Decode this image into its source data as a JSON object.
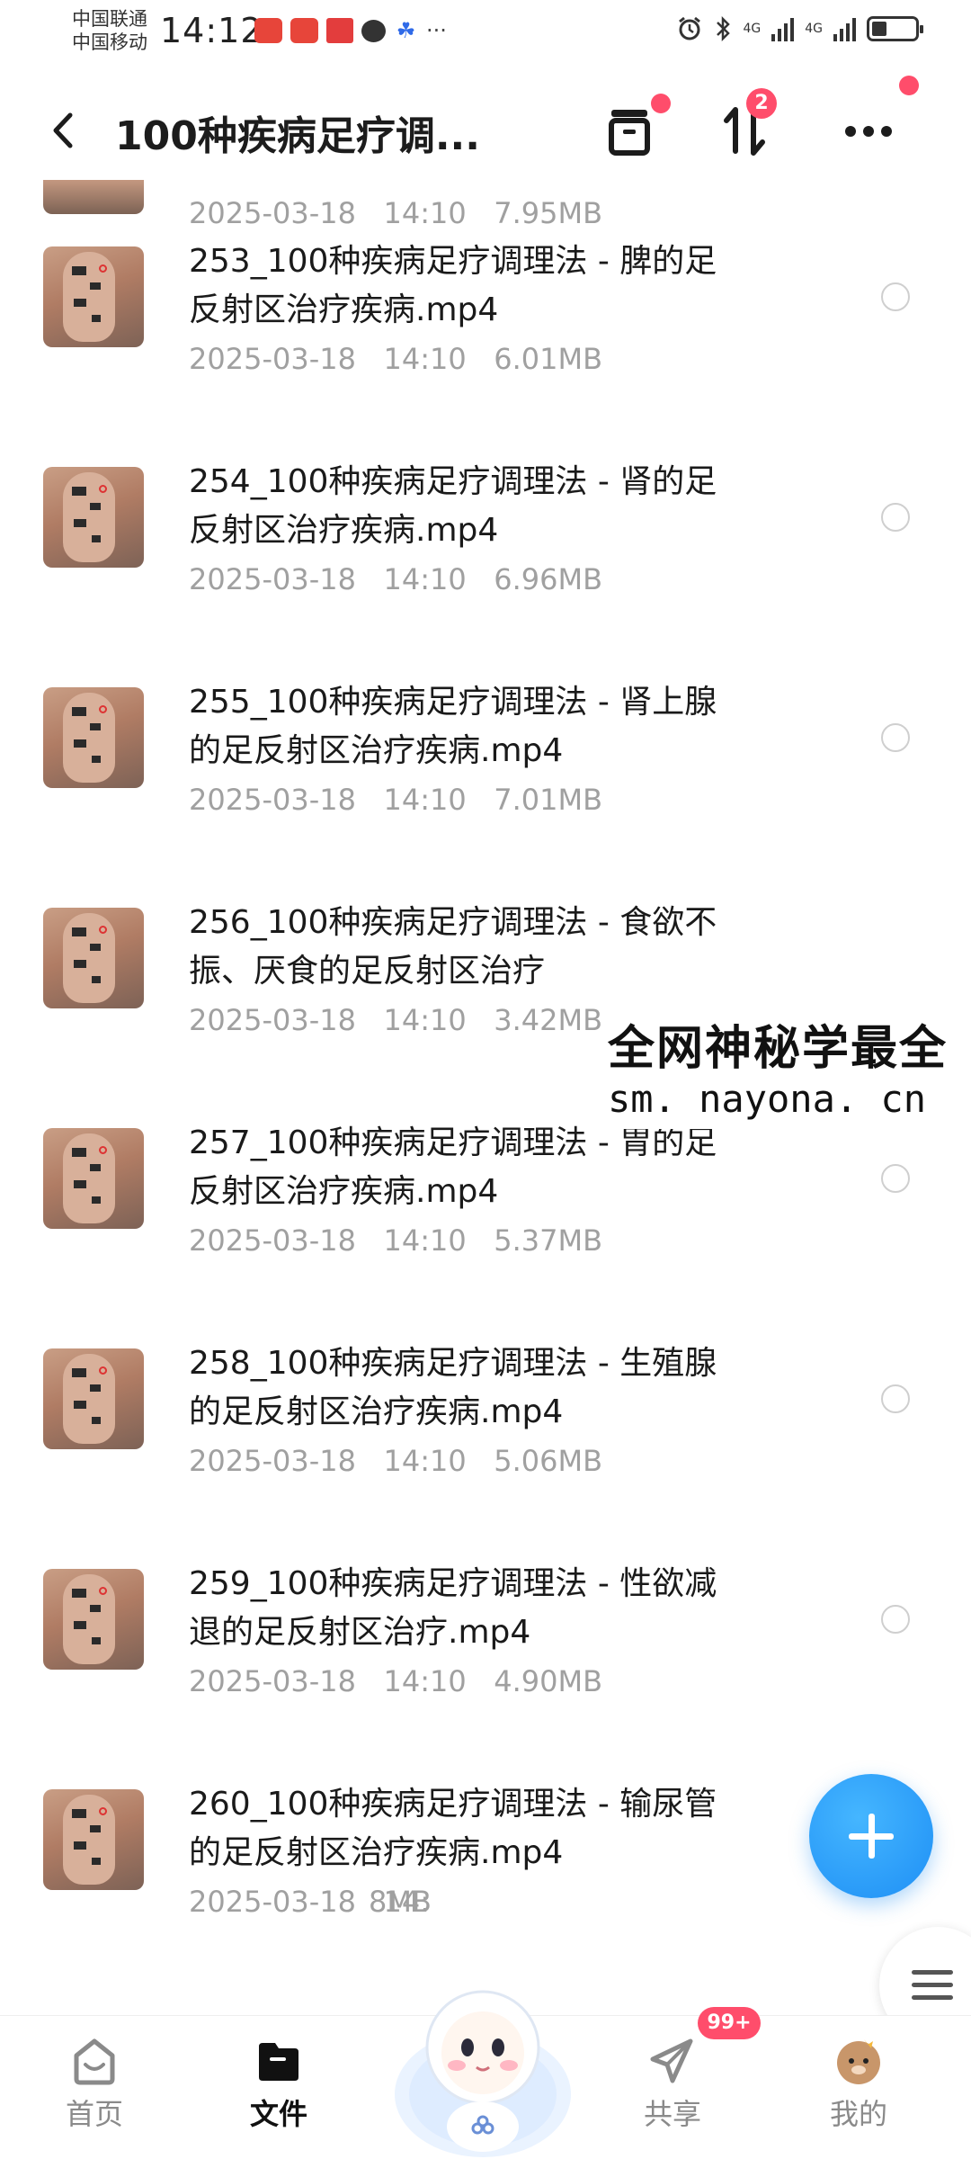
{
  "status_bar": {
    "carrier1": "中国联通",
    "carrier2": "中国移动",
    "time": "14:12",
    "signal1": "4G",
    "signal2": "4G"
  },
  "header": {
    "back_icon": "chevron-left-icon",
    "title": "100种疾病足疗调...",
    "sort_badge": "2"
  },
  "partial_item": {
    "meta": "2025-03-18   14:10   7.95MB"
  },
  "files": [
    {
      "name": "253_100种疾病足疗调理法 - 脾的足\n反射区治疗疾病.mp4",
      "meta": "2025-03-18   14:10   6.01MB"
    },
    {
      "name": "254_100种疾病足疗调理法 - 肾的足\n反射区治疗疾病.mp4",
      "meta": "2025-03-18   14:10   6.96MB"
    },
    {
      "name": "255_100种疾病足疗调理法 - 肾上腺\n的足反射区治疗疾病.mp4",
      "meta": "2025-03-18   14:10   7.01MB"
    },
    {
      "name": "256_100种疾病足疗调理法 - 食欲不\n振、厌食的足反射区治疗",
      "meta": "2025-03-18   14:10   3.42MB"
    },
    {
      "name": "257_100种疾病足疗调理法 - 胃的足\n反射区治疗疾病.mp4",
      "meta": "2025-03-18   14:10   5.37MB"
    },
    {
      "name": "258_100种疾病足疗调理法 - 生殖腺\n的足反射区治疗疾病.mp4",
      "meta": "2025-03-18   14:10   5.06MB"
    },
    {
      "name": "259_100种疾病足疗调理法 - 性欲减\n退的足反射区治疗.mp4",
      "meta": "2025-03-18   14:10   4.90MB"
    },
    {
      "name": "260_100种疾病足疗调理法 - 输尿管\n的足反射区治疗疾病.mp4",
      "meta": "2025-03-18   14:",
      "meta_tail": "8MB"
    }
  ],
  "watermark": {
    "line1": "全网神秘学最全",
    "line2": "sm. nayona. cn"
  },
  "bottom_nav": {
    "home": "首页",
    "files": "文件",
    "share": "共享",
    "share_badge": "99+",
    "me": "我的"
  },
  "colors": {
    "accent": "#1e8ff5",
    "badge": "#ff4d6b",
    "meta_text": "#a0a0a0"
  }
}
